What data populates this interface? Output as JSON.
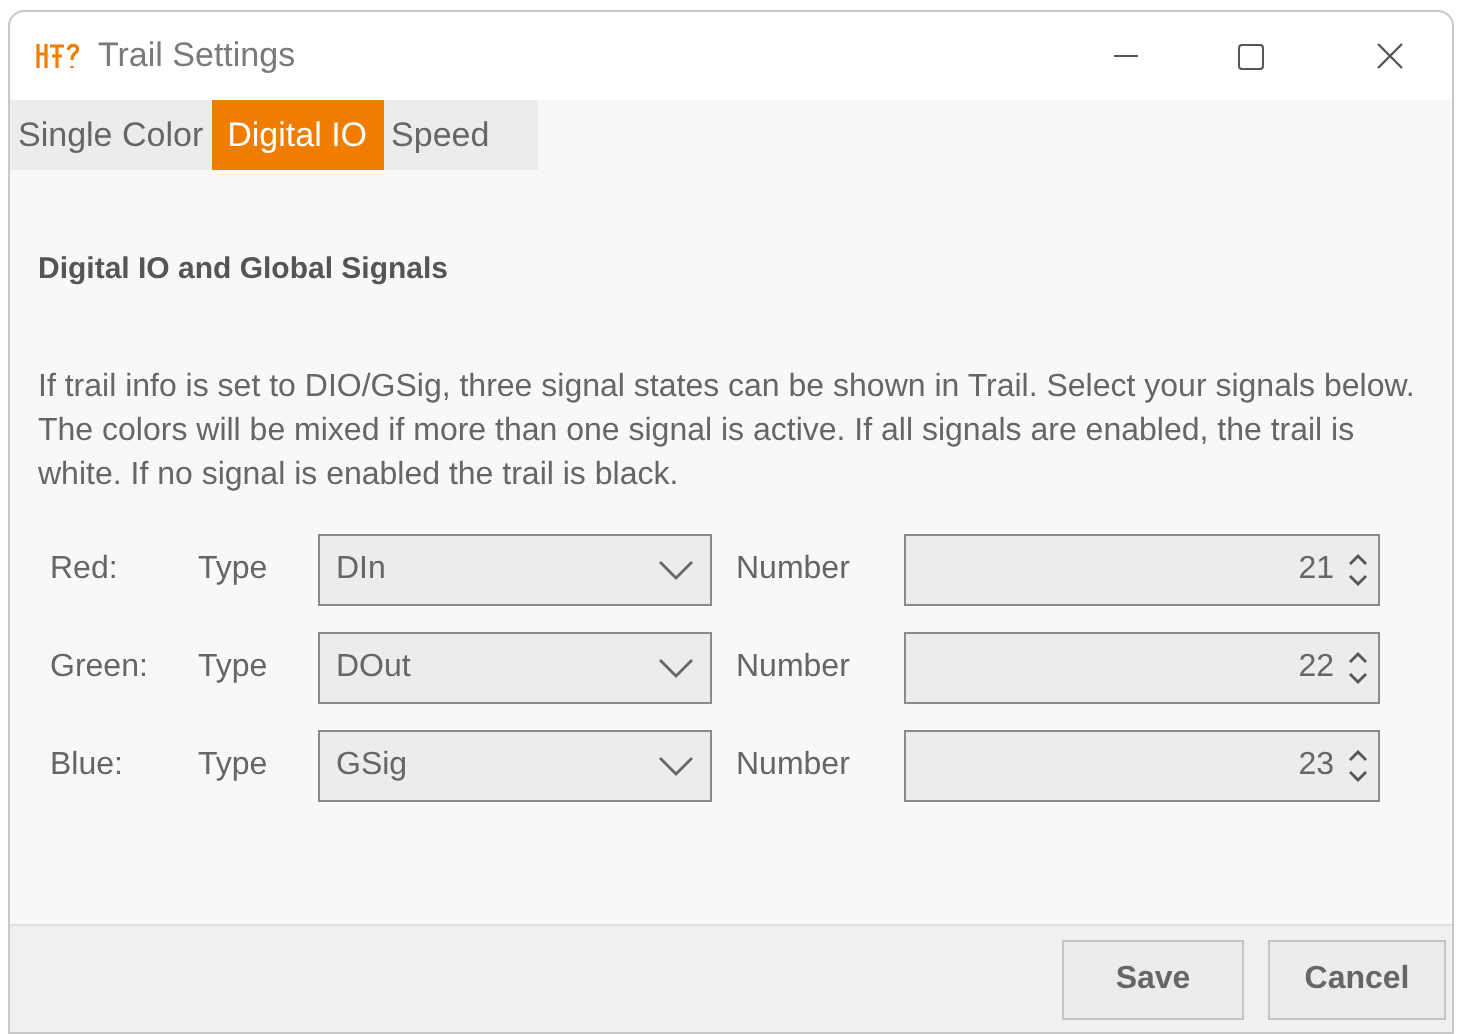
{
  "window": {
    "title": "Trail Settings"
  },
  "tabs": [
    {
      "label": "Single Color",
      "selected": false
    },
    {
      "label": "Digital IO",
      "selected": true
    },
    {
      "label": "Speed",
      "selected": false
    }
  ],
  "section": {
    "heading": "Digital IO and Global Signals",
    "description": "If trail info is set to DIO/GSig, three signal states can be shown in Trail. Select your signals below. The colors will be mixed if more than one signal is active. If all signals are enabled, the trail is white. If no signal is enabled the trail is black."
  },
  "signals": [
    {
      "label": "Red:",
      "type_label": "Type",
      "type": "DIn",
      "number_label": "Number",
      "number": "21"
    },
    {
      "label": "Green:",
      "type_label": "Type",
      "type": "DOut",
      "number_label": "Number",
      "number": "22"
    },
    {
      "label": "Blue:",
      "type_label": "Type",
      "type": "GSig",
      "number_label": "Number",
      "number": "23"
    }
  ],
  "buttons": [
    "Save",
    "Cancel"
  ]
}
